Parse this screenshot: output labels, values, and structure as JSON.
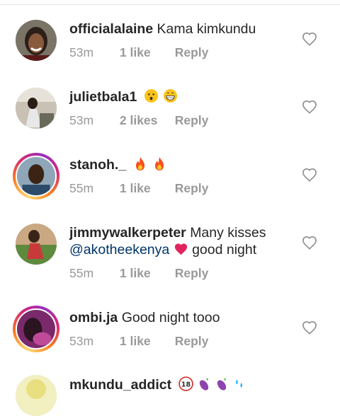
{
  "comments": [
    {
      "username": "officialalaine",
      "text": "Kama kimkundu",
      "time": "53m",
      "likes": "1 like",
      "reply": "Reply",
      "story_ring": false
    },
    {
      "username": "julietbala1",
      "text": "",
      "emojis": [
        "hushed-face-emoji",
        "grinning-face-emoji"
      ],
      "time": "53m",
      "likes": "2 likes",
      "reply": "Reply",
      "story_ring": false
    },
    {
      "username": "stanoh._",
      "text": "",
      "emojis": [
        "fire-emoji",
        "fire-emoji"
      ],
      "time": "55m",
      "likes": "1 like",
      "reply": "Reply",
      "story_ring": true
    },
    {
      "username": "jimmywalkerpeter",
      "text": "Many kisses",
      "mention": "@akotheekenya",
      "text_after": "good night",
      "emojis": [
        "heart-emoji"
      ],
      "time": "55m",
      "likes": "1 like",
      "reply": "Reply",
      "story_ring": false
    },
    {
      "username": "ombi.ja",
      "text": "Good night tooo",
      "time": "53m",
      "likes": "1 like",
      "reply": "Reply",
      "story_ring": true
    },
    {
      "username": "mkundu_addict",
      "text": "",
      "emojis": [
        "eighteen-plus-emoji",
        "eggplant-emoji",
        "eggplant-emoji",
        "droplets-emoji"
      ],
      "story_ring": false
    }
  ],
  "colors": {
    "username": "#262626",
    "meta": "#999999",
    "mention": "#003569",
    "heart": "#e0245e"
  },
  "icons": {
    "like": "heart-outline-icon"
  }
}
